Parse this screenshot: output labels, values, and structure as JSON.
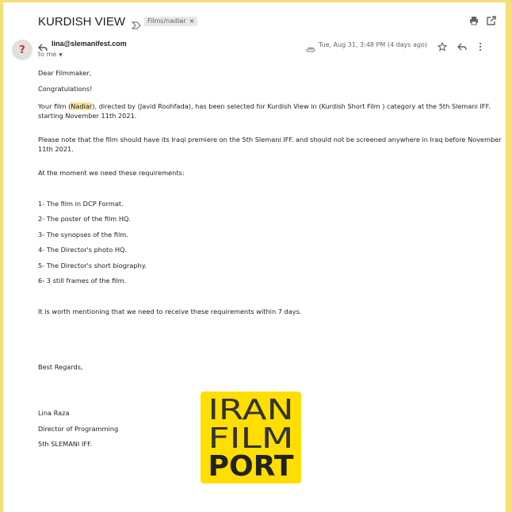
{
  "header": {
    "subject": "KURDISH VIEW",
    "label_chip": "Films/nadiar",
    "label_close": "×"
  },
  "message": {
    "avatar_glyph": "?",
    "sender": "lina@slemanifest.com",
    "to": "to me",
    "date": "Tue, Aug 31, 3:48 PM (4 days ago)"
  },
  "body": {
    "greeting": "Dear Filmmaker,",
    "congrats": "Congratulations!",
    "p1_a": "Your film (",
    "p1_film": "Nadiar",
    "p1_b": "), directed by (Javid Roohfada), has been selected for Kurdish View in (Kurdish Short Film ) category at the 5th Slemani IFF.",
    "p1_line2": "starting November 11th 2021.",
    "p2_line1": "Please note that the film should have its Iraqi premiere on the 5th Slemani IFF. and should not be screened anywhere in Iraq before November",
    "p2_line2": "11th 2021.",
    "p3": "At the moment we need these requirements:",
    "requirements": [
      "1- The film in DCP Format.",
      "2- The poster of the film HQ.",
      "3- The synopses of the film.",
      "4- The Director's photo HQ.",
      "5- The Director's short biography.",
      "6- 3 still frames of the film."
    ],
    "p4": "It is worth mentioning that we need to receive these requirements within 7 days.",
    "signoff": "Best Regards,",
    "sig_name": "Lina Raza",
    "sig_title": "Director of Programming",
    "sig_org": "5th SLEMANI IFF."
  },
  "logo": {
    "line1": "IRAN",
    "line2": "FILM",
    "line3": "PORT"
  },
  "colors": {
    "page_border": "#f6de76",
    "logo_bg": "#ffde00",
    "highlight": "#fbe49b",
    "avatar_mark": "#d93025"
  },
  "icons": [
    "important-marker-icon",
    "print-icon",
    "open-new-window-icon",
    "reply-icon",
    "attachment-icon",
    "star-icon",
    "more-vert-icon",
    "caret-down-icon"
  ]
}
